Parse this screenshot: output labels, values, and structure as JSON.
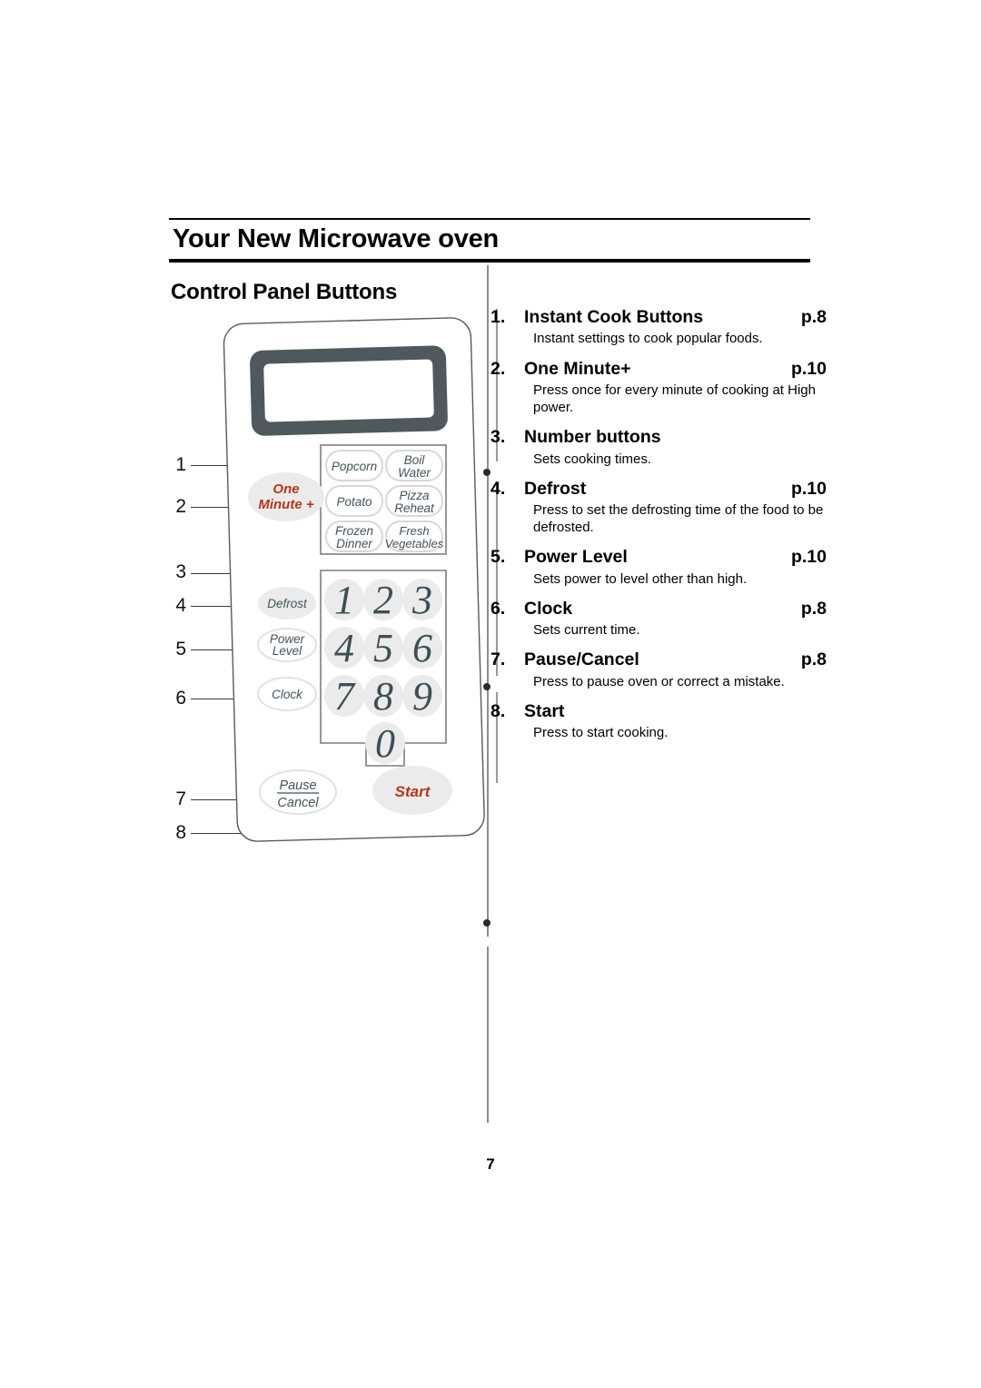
{
  "document": {
    "header_title": "Your New Microwave oven",
    "section_title": "Control Panel Buttons",
    "page_number": "7"
  },
  "spec_list": [
    {
      "num": "1.",
      "label": "Instant Cook Buttons",
      "page": "p.8",
      "desc": "Instant settings to cook popular foods."
    },
    {
      "num": "2.",
      "label": "One Minute+",
      "page": "p.10",
      "desc": "Press once for every minute of cooking at High power."
    },
    {
      "num": "3.",
      "label": "Number buttons",
      "page": "",
      "desc": "Sets cooking times."
    },
    {
      "num": "4.",
      "label": "Defrost",
      "page": "p.10",
      "desc": "Press to set the defrosting time of the food to be defrosted."
    },
    {
      "num": "5.",
      "label": "Power Level",
      "page": "p.10",
      "desc": "Sets power to level other than high."
    },
    {
      "num": "6.",
      "label": "Clock",
      "page": "p.8",
      "desc": "Sets current time."
    },
    {
      "num": "7.",
      "label": "Pause/Cancel",
      "page": "p.8",
      "desc": "Press to pause oven or correct a mistake."
    },
    {
      "num": "8.",
      "label": "Start",
      "page": "",
      "desc": "Press to start cooking."
    }
  ],
  "callouts": [
    "1",
    "2",
    "3",
    "4",
    "5",
    "6",
    "7",
    "8"
  ],
  "control_panel": {
    "display": {
      "label": "",
      "bezel_color": "#4e595e",
      "screen_color": "#ffffff"
    },
    "one_minute_button": {
      "line1": "One",
      "line2": "Minute +",
      "color": "#b4361d"
    },
    "instant_cook_buttons": [
      {
        "line1": "Popcorn",
        "line2": ""
      },
      {
        "line1": "Boil",
        "line2": "Water"
      },
      {
        "line1": "Potato",
        "line2": ""
      },
      {
        "line1": "Pizza",
        "line2": "Reheat"
      },
      {
        "line1": "Frozen",
        "line2": "Dinner"
      },
      {
        "line1": "Fresh",
        "line2": "Vegetables"
      }
    ],
    "side_buttons": [
      {
        "line1": "Defrost",
        "line2": ""
      },
      {
        "line1": "Power",
        "line2": "Level"
      },
      {
        "line1": "Clock",
        "line2": ""
      }
    ],
    "number_buttons": [
      "1",
      "2",
      "3",
      "4",
      "5",
      "6",
      "7",
      "8",
      "9",
      "0"
    ],
    "pause_cancel_button": {
      "line1": "Pause",
      "line2": "Cancel"
    },
    "start_button": {
      "label": "Start",
      "color": "#b4361d"
    }
  }
}
